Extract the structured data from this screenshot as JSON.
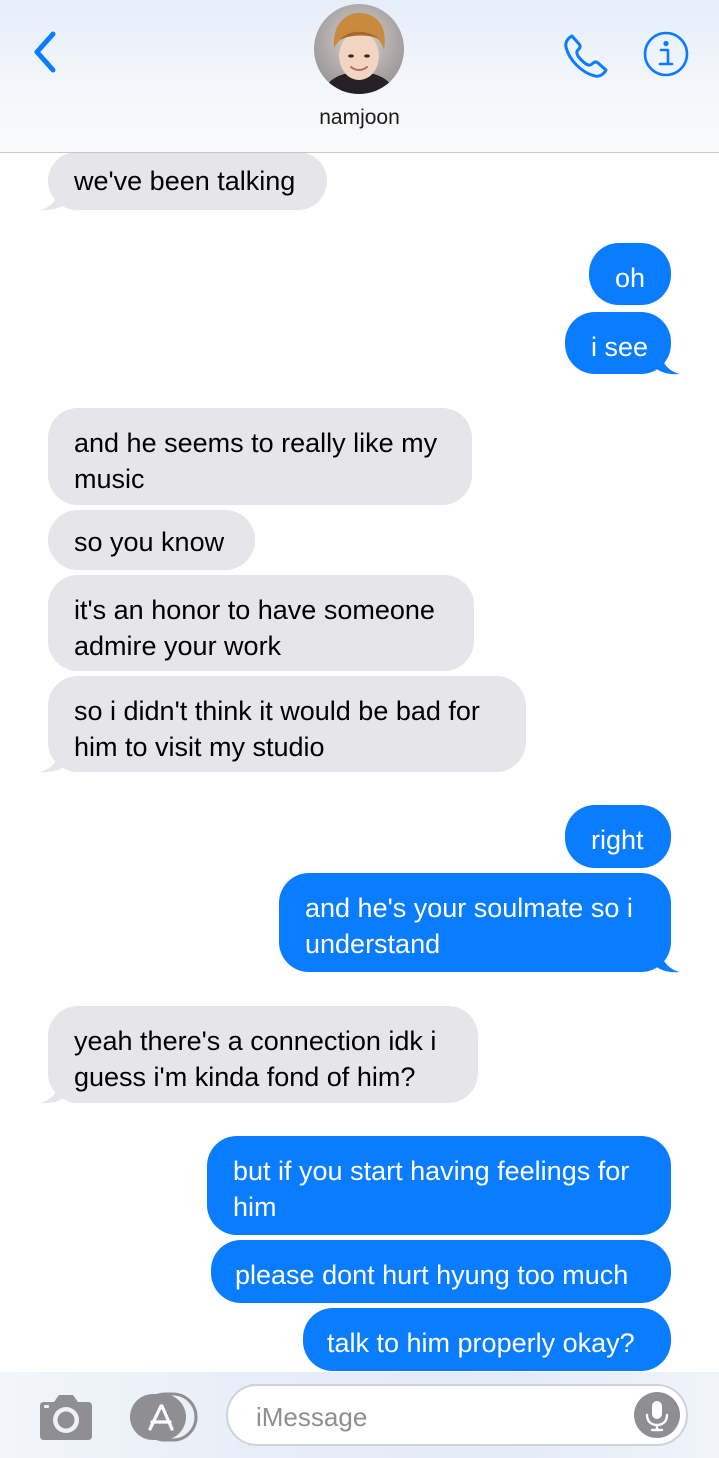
{
  "header": {
    "contact_name": "namjoon"
  },
  "icons": {
    "back": "chevron-left-icon",
    "call": "phone-icon",
    "info": "info-icon",
    "camera": "camera-icon",
    "apps": "app-store-icon",
    "mic": "microphone-icon"
  },
  "colors": {
    "accent": "#0a7cff",
    "received_bubble": "#e5e5ea"
  },
  "messages": [
    {
      "from": "them",
      "text": "we've been talking"
    },
    {
      "from": "me",
      "text": "oh"
    },
    {
      "from": "me",
      "text": "i see"
    },
    {
      "from": "them",
      "text": "and he seems to really like my music"
    },
    {
      "from": "them",
      "text": "so you know"
    },
    {
      "from": "them",
      "text": "it's an honor to have someone admire your work"
    },
    {
      "from": "them",
      "text": "so i didn't think it would be bad for him to visit my studio"
    },
    {
      "from": "me",
      "text": "right"
    },
    {
      "from": "me",
      "text": "and he's your soulmate so i understand"
    },
    {
      "from": "them",
      "text": "yeah there's a connection idk i guess i'm kinda fond of him?"
    },
    {
      "from": "me",
      "text": "but if you start having feelings for him"
    },
    {
      "from": "me",
      "text": "please dont hurt hyung too much"
    },
    {
      "from": "me",
      "text": "talk to him properly okay?"
    }
  ],
  "compose": {
    "placeholder": "iMessage"
  }
}
